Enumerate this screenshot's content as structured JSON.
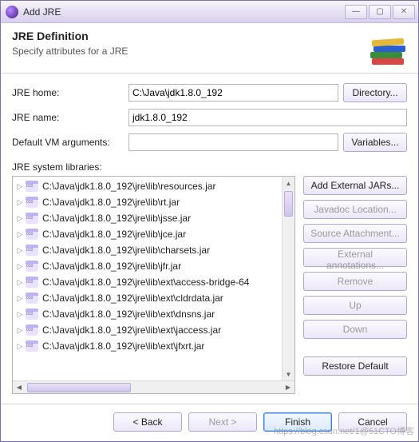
{
  "window": {
    "title": "Add JRE",
    "min_tip": "Minimize",
    "max_tip": "Maximize",
    "close_tip": "Close"
  },
  "header": {
    "title": "JRE Definition",
    "subtitle": "Specify attributes for a JRE"
  },
  "form": {
    "home_label": "JRE home:",
    "home_value": "C:\\Java\\jdk1.8.0_192",
    "directory_btn": "Directory...",
    "name_label": "JRE name:",
    "name_value": "jdk1.8.0_192",
    "args_label": "Default VM arguments:",
    "args_value": "",
    "variables_btn": "Variables...",
    "libs_label": "JRE system libraries:"
  },
  "libs": [
    "C:\\Java\\jdk1.8.0_192\\jre\\lib\\resources.jar",
    "C:\\Java\\jdk1.8.0_192\\jre\\lib\\rt.jar",
    "C:\\Java\\jdk1.8.0_192\\jre\\lib\\jsse.jar",
    "C:\\Java\\jdk1.8.0_192\\jre\\lib\\jce.jar",
    "C:\\Java\\jdk1.8.0_192\\jre\\lib\\charsets.jar",
    "C:\\Java\\jdk1.8.0_192\\jre\\lib\\jfr.jar",
    "C:\\Java\\jdk1.8.0_192\\jre\\lib\\ext\\access-bridge-64",
    "C:\\Java\\jdk1.8.0_192\\jre\\lib\\ext\\cldrdata.jar",
    "C:\\Java\\jdk1.8.0_192\\jre\\lib\\ext\\dnsns.jar",
    "C:\\Java\\jdk1.8.0_192\\jre\\lib\\ext\\jaccess.jar",
    "C:\\Java\\jdk1.8.0_192\\jre\\lib\\ext\\jfxrt.jar"
  ],
  "lib_buttons": {
    "add_external": "Add External JARs...",
    "javadoc": "Javadoc Location...",
    "source": "Source Attachment...",
    "annotations": "External annotations...",
    "remove": "Remove",
    "up": "Up",
    "down": "Down",
    "restore": "Restore Default"
  },
  "footer": {
    "back": "< Back",
    "next": "Next >",
    "finish": "Finish",
    "cancel": "Cancel"
  },
  "watermark": "https://blog.csdn.net/1@51CTO博客"
}
